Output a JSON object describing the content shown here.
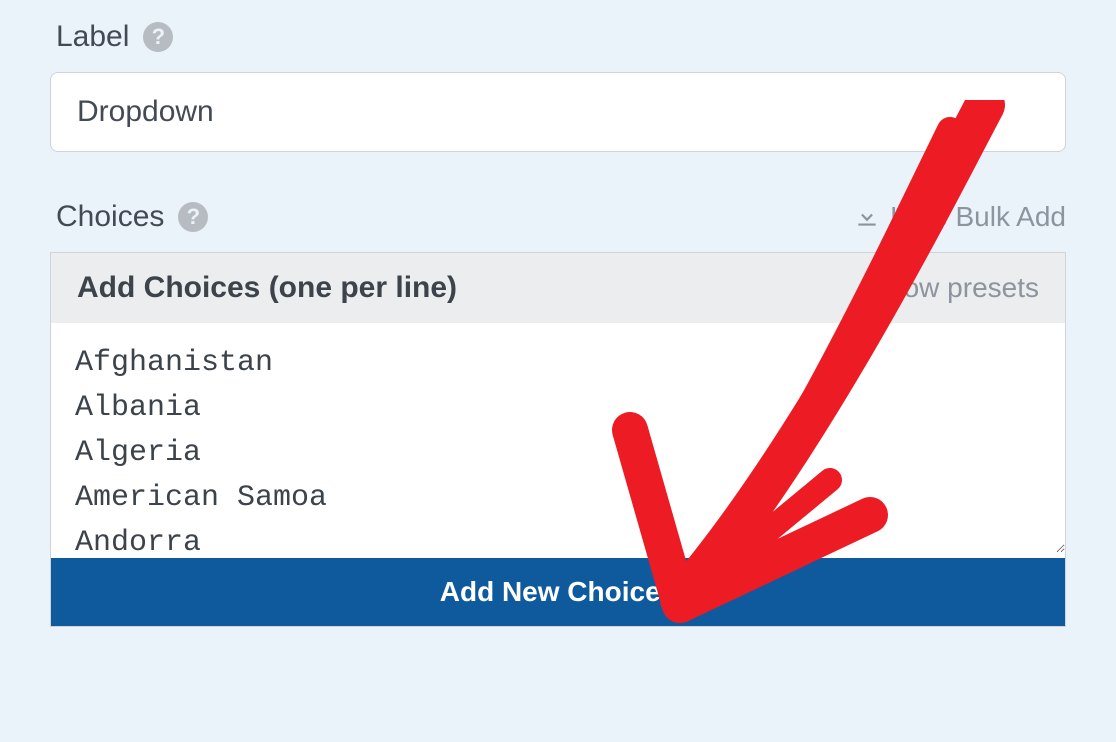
{
  "labelSection": {
    "title": "Label",
    "value": "Dropdown"
  },
  "choicesSection": {
    "title": "Choices",
    "toggleText": "Hide Bulk Add",
    "boxTitle": "Add Choices (one per line)",
    "presetsText": "Show presets",
    "textareaValue": "Afghanistan\nAlbania\nAlgeria\nAmerican Samoa\nAndorra",
    "addButton": "Add New Choices"
  },
  "annotation": {
    "color": "#ed1c24"
  }
}
